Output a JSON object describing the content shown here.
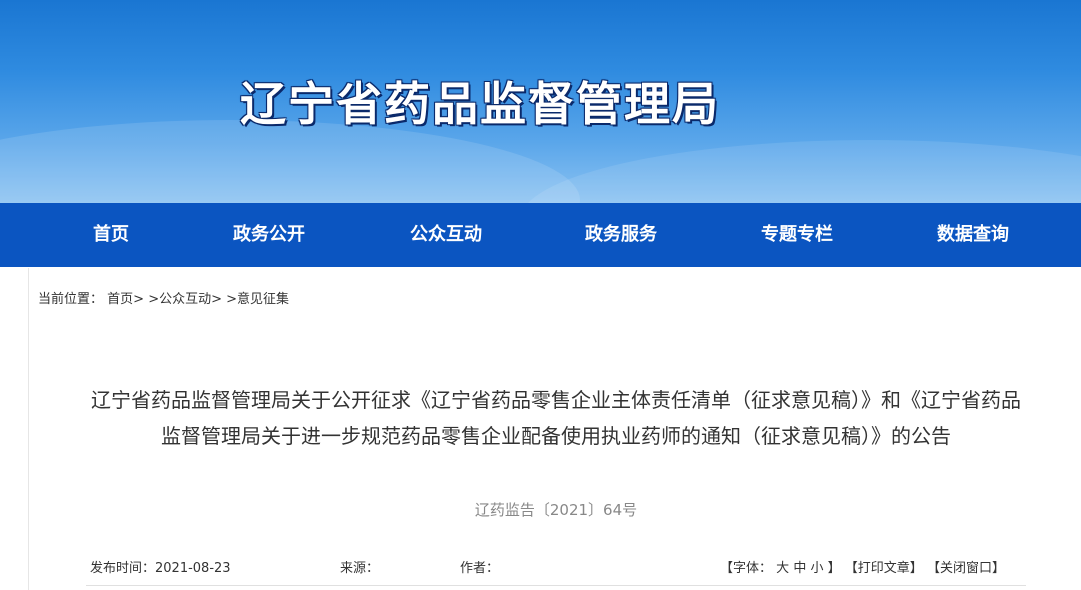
{
  "site": {
    "title": "辽宁省药品监督管理局"
  },
  "nav": {
    "items": [
      {
        "label": "首页"
      },
      {
        "label": "政务公开"
      },
      {
        "label": "公众互动"
      },
      {
        "label": "政务服务"
      },
      {
        "label": "专题专栏"
      },
      {
        "label": "数据查询"
      }
    ]
  },
  "breadcrumb": {
    "prefix": "当前位置：",
    "home": "首页",
    "sep1": "> >",
    "section": "公众互动",
    "sep2": "> >",
    "current": "意见征集"
  },
  "article": {
    "title": "辽宁省药品监督管理局关于公开征求《辽宁省药品零售企业主体责任清单（征求意见稿）》和《辽宁省药品监督管理局关于进一步规范药品零售企业配备使用执业药师的通知（征求意见稿）》的公告",
    "doc_number": "辽药监告〔2021〕64号",
    "published_label": "发布时间：",
    "published_value": "2021-08-23",
    "source_label": "来源：",
    "source_value": "",
    "author_label": "作者：",
    "author_value": ""
  },
  "tools": {
    "font_open": "【字体：",
    "font_large": "大",
    "font_medium": "中",
    "font_small": "小",
    "font_close": "】",
    "print": "【打印文章】",
    "close_window": "【关闭窗口】"
  },
  "colors": {
    "nav_bg": "#0b55c1",
    "banner_top": "#1a76d2",
    "banner_bottom": "#8cc3f2"
  }
}
